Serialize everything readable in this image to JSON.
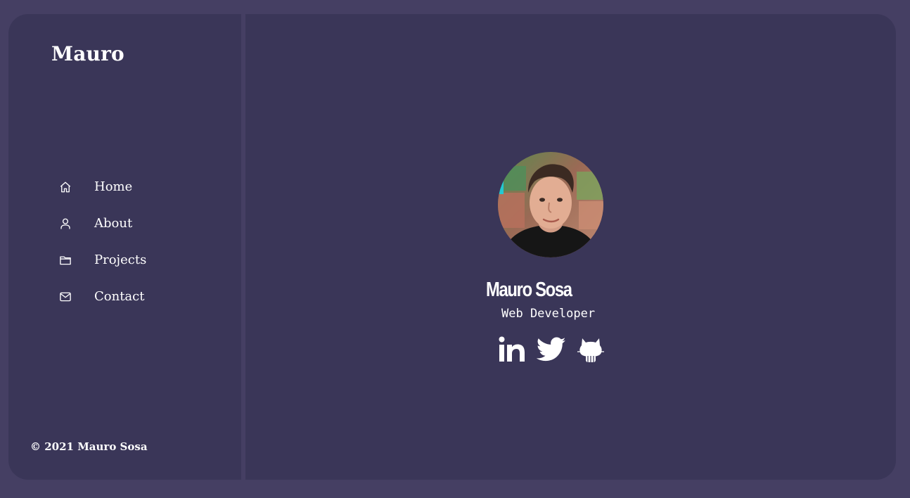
{
  "brand": {
    "name": "Mauro"
  },
  "nav": {
    "items": [
      {
        "label": "Home",
        "icon": "home-icon"
      },
      {
        "label": "About",
        "icon": "user-icon"
      },
      {
        "label": "Projects",
        "icon": "folder-icon"
      },
      {
        "label": "Contact",
        "icon": "mail-icon"
      }
    ]
  },
  "footer": {
    "copyright": "© 2021 Mauro Sosa"
  },
  "profile": {
    "name": "Mauro Sosa",
    "role": "Web Developer",
    "avatar": "profile-photo"
  },
  "socials": [
    {
      "icon": "linkedin-icon"
    },
    {
      "icon": "twitter-icon"
    },
    {
      "icon": "github-icon"
    }
  ],
  "colors": {
    "page_background": "#453f63",
    "panel_background": "#3a3658",
    "text": "#ffffff"
  }
}
